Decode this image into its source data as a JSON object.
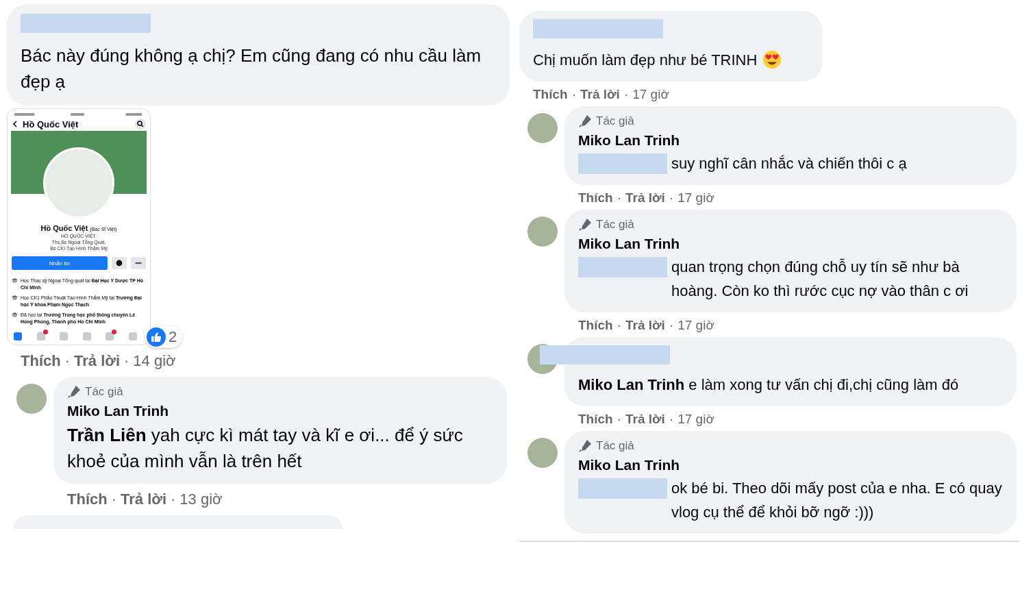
{
  "separator": "·",
  "columns": [
    {
      "divider": false,
      "comments": [
        {
          "kind": "comment",
          "avatar": false,
          "name_redacted": true,
          "text": "Bác này đúng không ạ chị? Em cũng đang có nhu cầu làm đẹp ạ",
          "attachment": {
            "header_title": "Hồ Quốc Việt",
            "profile_name": "Hồ Quốc Việt",
            "profile_nickname": "(Bác Sĩ Việt)",
            "bio": [
              "HỒ QUỐC VIỆT,",
              "Ths.Bs Ngoại Tổng Quát,",
              "Bs CKI Tạo Hình Thẩm Mỹ"
            ],
            "message_button": "Nhắn tin",
            "education": [
              "Học Thạc sỹ Ngoại Tổng quát tại **Đại Học Y Dược TP Hồ Chí Minh**",
              "Học CK1 Phẫu Thuật Tạo Hình Thẩm Mỹ tại **Trường Đại học Y khoa Phạm Ngọc Thạch**",
              "Đã học tại **Trường Trung học phổ thông chuyên Lê Hồng Phong, Thành phố Hồ Chí Minh**"
            ],
            "tabs": [
              {
                "selected": true,
                "badge": false
              },
              {
                "selected": false,
                "badge": true
              },
              {
                "selected": false,
                "badge": false
              },
              {
                "selected": false,
                "badge": false
              },
              {
                "selected": false,
                "badge": true
              },
              {
                "selected": false,
                "badge": false
              }
            ]
          },
          "reactions": "2",
          "actions": {
            "like": "Thích",
            "reply": "Trả lời",
            "time": "14 giờ"
          }
        },
        {
          "kind": "comment",
          "avatar": true,
          "author_badge": "Tác giả",
          "author": "Miko Lan Trinh",
          "text": "**Trần Liên** yah cực kì mát tay và kĩ e ơi... để ý sức khoẻ của mình vẫn là trên hết",
          "actions": {
            "like": "Thích",
            "reply": "Trả lời",
            "time": "13 giờ"
          }
        },
        {
          "kind": "stub"
        }
      ]
    },
    {
      "divider": true,
      "comments": [
        {
          "kind": "comment",
          "avatar": false,
          "name_redacted": true,
          "text": "Chị muốn làm đẹp như bé TRINH",
          "has_emoji": true,
          "actions": {
            "like": "Thích",
            "reply": "Trả lời",
            "time": "17 giờ"
          }
        },
        {
          "kind": "comment",
          "avatar": true,
          "author_badge": "Tác giả",
          "author": "Miko Lan Trinh",
          "mention_redacted": true,
          "text": "suy nghĩ cân nhắc và chiến thôi c ạ",
          "actions": {
            "like": "Thích",
            "reply": "Trả lời",
            "time": "17 giờ"
          }
        },
        {
          "kind": "comment",
          "avatar": true,
          "author_badge": "Tác giả",
          "author": "Miko Lan Trinh",
          "mention_redacted": true,
          "text": "quan trọng chọn đúng chỗ uy tín sẽ như bà hoàng. Còn ko thì rước cục nợ vào thân c ơi",
          "actions": {
            "like": "Thích",
            "reply": "Trả lời",
            "time": "17 giờ"
          }
        },
        {
          "kind": "comment",
          "avatar": true,
          "name_redacted": true,
          "text": "**Miko Lan Trinh** e làm xong tư vấn chị đi,chị cũng làm đó",
          "actions": {
            "like": "Thích",
            "reply": "Trả lời",
            "time": "17 giờ"
          }
        },
        {
          "kind": "comment",
          "avatar": true,
          "author_badge": "Tác giả",
          "author": "Miko Lan Trinh",
          "mention_redacted": true,
          "text": "ok bé bi. Theo dõi mấy post của e nha. E có quay vlog cụ thể để khỏi bỡ ngỡ :)))"
        }
      ]
    }
  ]
}
